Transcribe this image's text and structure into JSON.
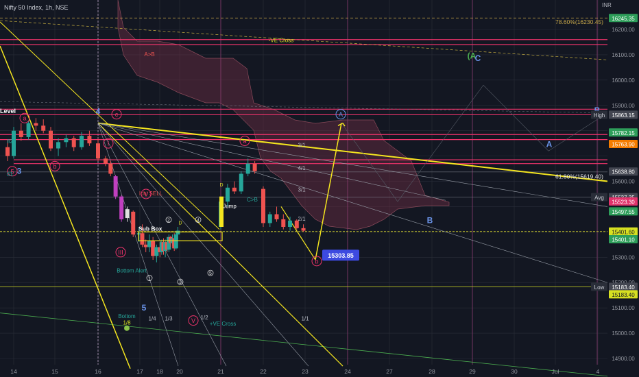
{
  "header": {
    "title": "Nifty 50 Index, 1h, NSE"
  },
  "colors": {
    "background": "#131722",
    "grid": "#2a2e39",
    "bull": "#26a69a",
    "bear": "#ef5350",
    "yellow": "#f5e61f",
    "pink": "#f0336b",
    "blue": "#6a93e8",
    "green": "#4caf50",
    "cloud": "#6e2f44",
    "label_green": "#2e9e5a",
    "label_orange": "#f57c00",
    "label_yellow": "#d7e021",
    "label_blue": "#3d4ae0"
  },
  "chart_data": {
    "type": "candlestick",
    "symbol": "Nifty 50 Index",
    "interval": "1h",
    "exchange": "NSE",
    "currency": "INR",
    "ylim": [
      14860,
      16300
    ],
    "y_ticks": [
      14900,
      15000,
      15100,
      15200,
      15300,
      15400,
      15500,
      15600,
      15700,
      15800,
      15900,
      16000,
      16100,
      16200
    ],
    "x_ticks": [
      {
        "label": "14",
        "day": 14
      },
      {
        "label": "15",
        "day": 15
      },
      {
        "label": "16",
        "day": 16
      },
      {
        "label": "17",
        "day": 17
      },
      {
        "label": "18",
        "day": 18
      },
      {
        "label": "20",
        "day": 20
      },
      {
        "label": "21",
        "day": 21
      },
      {
        "label": "22",
        "day": 22
      },
      {
        "label": "23",
        "day": 23
      },
      {
        "label": "24",
        "day": 24
      },
      {
        "label": "27",
        "day": 27
      },
      {
        "label": "28",
        "day": 28
      },
      {
        "label": "29",
        "day": 29
      },
      {
        "label": "30",
        "day": 30
      },
      {
        "label": "Jul",
        "day": 31
      },
      {
        "label": "4",
        "day": 32
      }
    ],
    "xlim": [
      13.8,
      32.7
    ],
    "candles": [
      {
        "t": 13.85,
        "o": 15735,
        "h": 15765,
        "l": 15680,
        "c": 15700
      },
      {
        "t": 14.0,
        "o": 15700,
        "h": 15815,
        "l": 15690,
        "c": 15800
      },
      {
        "t": 14.18,
        "o": 15800,
        "h": 15830,
        "l": 15760,
        "c": 15775
      },
      {
        "t": 14.36,
        "o": 15775,
        "h": 15840,
        "l": 15765,
        "c": 15830
      },
      {
        "t": 14.54,
        "o": 15830,
        "h": 15850,
        "l": 15800,
        "c": 15820
      },
      {
        "t": 14.72,
        "o": 15820,
        "h": 15845,
        "l": 15790,
        "c": 15800
      },
      {
        "t": 14.9,
        "o": 15800,
        "h": 15815,
        "l": 15720,
        "c": 15730
      },
      {
        "t": 15.08,
        "o": 15730,
        "h": 15770,
        "l": 15700,
        "c": 15755
      },
      {
        "t": 15.26,
        "o": 15755,
        "h": 15785,
        "l": 15735,
        "c": 15770
      },
      {
        "t": 15.44,
        "o": 15770,
        "h": 15780,
        "l": 15720,
        "c": 15735
      },
      {
        "t": 15.62,
        "o": 15735,
        "h": 15795,
        "l": 15725,
        "c": 15780
      },
      {
        "t": 15.8,
        "o": 15780,
        "h": 15800,
        "l": 15740,
        "c": 15750
      },
      {
        "t": 16.0,
        "o": 15750,
        "h": 15770,
        "l": 15680,
        "c": 15690
      },
      {
        "t": 16.18,
        "o": 15690,
        "h": 15700,
        "l": 15660,
        "c": 15670
      },
      {
        "t": 16.3,
        "o": 15670,
        "h": 15680,
        "l": 15620,
        "c": 15630
      },
      {
        "t": 16.42,
        "o": 15620,
        "h": 15625,
        "l": 15530,
        "c": 15540
      },
      {
        "t": 16.56,
        "o": 15540,
        "h": 15545,
        "l": 15440,
        "c": 15450
      },
      {
        "t": 16.7,
        "o": 15455,
        "h": 15500,
        "l": 15440,
        "c": 15490
      },
      {
        "t": 16.84,
        "o": 15480,
        "h": 15485,
        "l": 15380,
        "c": 15390
      },
      {
        "t": 16.98,
        "o": 15390,
        "h": 15420,
        "l": 15360,
        "c": 15395
      },
      {
        "t": 17.12,
        "o": 15395,
        "h": 15430,
        "l": 15340,
        "c": 15350
      },
      {
        "t": 17.3,
        "o": 15350,
        "h": 15370,
        "l": 15320,
        "c": 15340
      },
      {
        "t": 17.48,
        "o": 15340,
        "h": 15390,
        "l": 15320,
        "c": 15365
      },
      {
        "t": 17.66,
        "o": 15365,
        "h": 15380,
        "l": 15290,
        "c": 15305
      },
      {
        "t": 17.84,
        "o": 15305,
        "h": 15350,
        "l": 15280,
        "c": 15340
      },
      {
        "t": 18.02,
        "o": 15340,
        "h": 15360,
        "l": 15300,
        "c": 15320
      },
      {
        "t": 18.2,
        "o": 15320,
        "h": 15370,
        "l": 15310,
        "c": 15360
      },
      {
        "t": 18.38,
        "o": 15360,
        "h": 15375,
        "l": 15310,
        "c": 15325
      },
      {
        "t": 18.56,
        "o": 15325,
        "h": 15370,
        "l": 15300,
        "c": 15360
      },
      {
        "t": 18.74,
        "o": 15360,
        "h": 15380,
        "l": 15320,
        "c": 15330
      },
      {
        "t": 18.92,
        "o": 15330,
        "h": 15390,
        "l": 15320,
        "c": 15380
      },
      {
        "t": 19.1,
        "o": 15380,
        "h": 15385,
        "l": 15340,
        "c": 15355
      },
      {
        "t": 19.28,
        "o": 15355,
        "h": 15390,
        "l": 15345,
        "c": 15375
      },
      {
        "t": 19.46,
        "o": 15375,
        "h": 15395,
        "l": 15325,
        "c": 15335
      },
      {
        "t": 19.64,
        "o": 15335,
        "h": 15400,
        "l": 15330,
        "c": 15390
      },
      {
        "t": 19.82,
        "o": 15390,
        "h": 15420,
        "l": 15370,
        "c": 15405
      },
      {
        "t": 21.0,
        "o": 15420,
        "h": 15530,
        "l": 15410,
        "c": 15520
      },
      {
        "t": 21.16,
        "o": 15520,
        "h": 15590,
        "l": 15500,
        "c": 15575
      },
      {
        "t": 21.32,
        "o": 15575,
        "h": 15600,
        "l": 15550,
        "c": 15560
      },
      {
        "t": 21.48,
        "o": 15560,
        "h": 15640,
        "l": 15550,
        "c": 15630
      },
      {
        "t": 21.64,
        "o": 15630,
        "h": 15690,
        "l": 15620,
        "c": 15670
      },
      {
        "t": 21.8,
        "o": 15670,
        "h": 15680,
        "l": 15630,
        "c": 15640
      },
      {
        "t": 22.0,
        "o": 15570,
        "h": 15580,
        "l": 15420,
        "c": 15435
      },
      {
        "t": 22.16,
        "o": 15435,
        "h": 15480,
        "l": 15420,
        "c": 15470
      },
      {
        "t": 22.32,
        "o": 15470,
        "h": 15500,
        "l": 15440,
        "c": 15450
      },
      {
        "t": 22.48,
        "o": 15450,
        "h": 15470,
        "l": 15410,
        "c": 15420
      },
      {
        "t": 22.64,
        "o": 15420,
        "h": 15460,
        "l": 15405,
        "c": 15445
      },
      {
        "t": 22.8,
        "o": 15445,
        "h": 15450,
        "l": 15410,
        "c": 15415
      },
      {
        "t": 22.96,
        "o": 15415,
        "h": 15430,
        "l": 15400,
        "c": 15405
      }
    ],
    "price_labels": [
      {
        "text": "16245.35",
        "value": 16245.35,
        "color": "label_green"
      },
      {
        "text": "16200.00",
        "value": 16200
      },
      {
        "text": "16100.00",
        "value": 16100
      },
      {
        "text": "16000.00",
        "value": 16000
      },
      {
        "text": "15900.00",
        "value": 15900
      },
      {
        "text": "15863.15",
        "value": 15863.15,
        "color": "grey",
        "tag": "High"
      },
      {
        "text": "15782.15",
        "value": 15782.15,
        "color": "label_green"
      },
      {
        "text": "15763.90",
        "value": 15763.9,
        "color": "label_orange"
      },
      {
        "text": "15638.80",
        "value": 15638.8,
        "color": "grey"
      },
      {
        "text": "15600.00",
        "value": 15600
      },
      {
        "text": "15537.35",
        "value": 15537.35,
        "color": "grey",
        "tag": "Avg"
      },
      {
        "text": "15523.30",
        "value": 15523.3,
        "color": "label_pink"
      },
      {
        "text": "15497.55",
        "value": 15497.55,
        "color": "label_green"
      },
      {
        "text": "15401.60",
        "value": 15401.6,
        "color": "label_yellow"
      },
      {
        "text": "15401.10",
        "value": 15401.1,
        "color": "label_green"
      },
      {
        "text": "15300.00",
        "value": 15300
      },
      {
        "text": "15200.00",
        "value": 15200
      },
      {
        "text": "15183.40",
        "value": 15183.4,
        "color": "grey",
        "tag": "Low"
      },
      {
        "text": "15183.40",
        "value": 15183.4,
        "color": "label_yellow"
      },
      {
        "text": "15100.00",
        "value": 15100
      },
      {
        "text": "15000.00",
        "value": 15000
      },
      {
        "text": "14900.00",
        "value": 14900
      }
    ],
    "price_axis_unit": "INR",
    "annotations": {
      "fib_786": "78.60%(16230.45)",
      "fib_618": "61.80%(15619.40)",
      "callout_price": "15303.85",
      "level_label": "Level",
      "ichi_sell": "Ichi SELL",
      "sub_box": "Sub Box",
      "bottom_alert": "Bottom Alert",
      "bottom": "Bottom",
      "one_eighth": "1/8",
      "ve_cross_minus": "-VE Cross",
      "ve_cross_plus": "+VE Cross",
      "jump": "Jump",
      "a_gt_b": "A>B",
      "c_gt_b": "C>B",
      "gann_labels": [
        "3/1",
        "4/1",
        "3/1",
        "2/1",
        "1/1",
        "1/4",
        "1/3",
        "1/2"
      ],
      "wave_labels": {
        "four": "4",
        "three": "3",
        "five": "5",
        "five_circle": "5",
        "a_circle": "a",
        "b_circle": "b",
        "c_circle": "c",
        "i_circle": "I",
        "iii_circle": "III",
        "v_circle": "V",
        "v2_circle": "V",
        "a_circle2": "a",
        "b_circle2": "b",
        "A": "A",
        "B": "B",
        "B2": "B",
        "A_circle": "A",
        "AC": "(A",
        "C": "C",
        "sub_1": "1",
        "sub_2": "2",
        "sub_3": "3",
        "sub_4": "4",
        "sub_5": "5",
        "left_82": "82",
        "left_61": "61",
        "sub_d": "D",
        "sub_d2": "D"
      }
    }
  }
}
